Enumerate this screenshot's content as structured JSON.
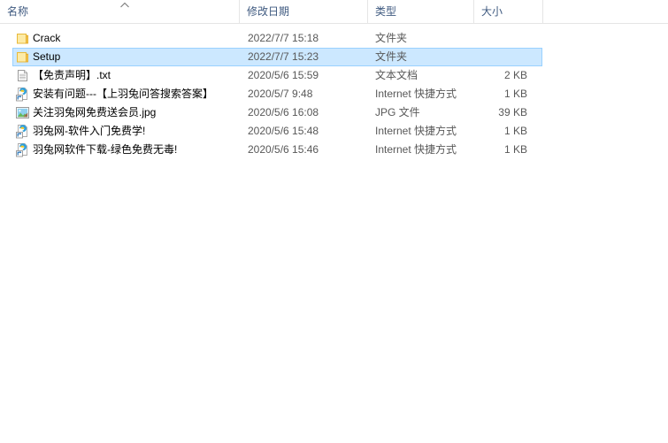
{
  "columns": [
    {
      "key": "name",
      "label": "名称",
      "sort": "ascending"
    },
    {
      "key": "date",
      "label": "修改日期",
      "sort": "none"
    },
    {
      "key": "type",
      "label": "类型",
      "sort": "none"
    },
    {
      "key": "size",
      "label": "大小",
      "sort": "none"
    }
  ],
  "header": {
    "name_label": "名称",
    "date_label": "修改日期",
    "type_label": "类型",
    "size_label": "大小",
    "sort_icon": "chevron-up-icon"
  },
  "colors": {
    "selection_fill": "#cce8ff",
    "selection_border": "#99d1ff",
    "header_text": "#3f5a80",
    "row_text": "#000000",
    "secondary_text": "#585858",
    "separator": "#e5e5e5",
    "folder_body": "#ffe9a0",
    "folder_tab": "#f5c23a"
  },
  "rows": [
    {
      "name": "Crack",
      "date": "2022/7/7 15:18",
      "type": "文件夹",
      "size": "",
      "icon": "folder-icon",
      "selected": false
    },
    {
      "name": "Setup",
      "date": "2022/7/7 15:23",
      "type": "文件夹",
      "size": "",
      "icon": "folder-icon",
      "selected": true
    },
    {
      "name": "【免责声明】.txt",
      "date": "2020/5/6 15:59",
      "type": "文本文档",
      "size": "2 KB",
      "icon": "text-document-icon",
      "selected": false
    },
    {
      "name": "安装有问题---【上羽兔问答搜索答案】",
      "date": "2020/5/7 9:48",
      "type": "Internet 快捷方式",
      "size": "1 KB",
      "icon": "internet-shortcut-icon",
      "selected": false
    },
    {
      "name": "关注羽兔网免费送会员.jpg",
      "date": "2020/5/6 16:08",
      "type": "JPG 文件",
      "size": "39 KB",
      "icon": "image-thumbnail-icon",
      "selected": false
    },
    {
      "name": "羽兔网-软件入门免费学!",
      "date": "2020/5/6 15:48",
      "type": "Internet 快捷方式",
      "size": "1 KB",
      "icon": "internet-shortcut-icon",
      "selected": false
    },
    {
      "name": "羽兔网软件下载-绿色免费无毒!",
      "date": "2020/5/6 15:46",
      "type": "Internet 快捷方式",
      "size": "1 KB",
      "icon": "internet-shortcut-icon",
      "selected": false
    }
  ]
}
